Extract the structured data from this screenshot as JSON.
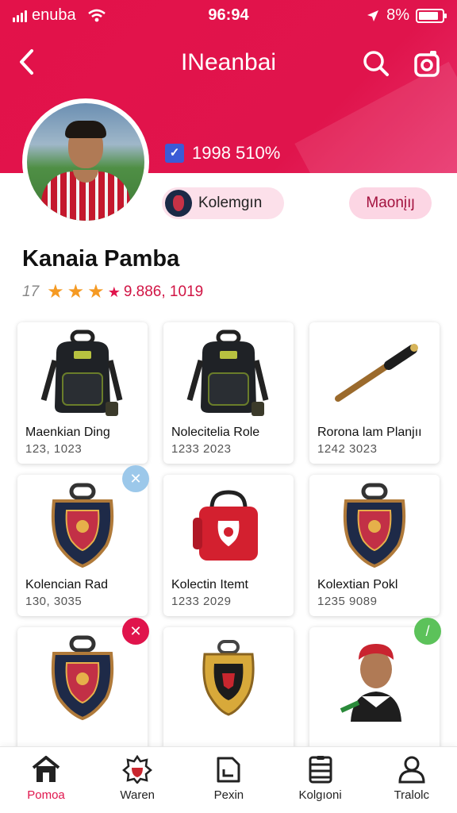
{
  "status_bar": {
    "carrier": "enuba",
    "time": "96:94",
    "battery": "8%"
  },
  "nav": {
    "title": "INeanbai",
    "back_icon": "chevron-left-icon",
    "search_icon": "search-icon",
    "camera_icon": "camera-icon"
  },
  "profile": {
    "verified_text": "1998 510%",
    "collection_label": "Kolemgın",
    "manage_label": "Maonįıȷ",
    "name": "Kanaia Pamba",
    "rating_number": "17",
    "rating_stars": 4,
    "rating_count": "9.886, 1019"
  },
  "items": [
    {
      "label": "Maenkian Ding",
      "code": "123, 1023",
      "image": "backpack-icon"
    },
    {
      "label": "Nolecitelia Role",
      "code": "1233 2023",
      "image": "backpack-icon"
    },
    {
      "label": "Rorona lam Planjıı",
      "code": "1242 3023",
      "image": "bat-icon"
    },
    {
      "label": "Kolencian Rad",
      "code": "130, 3035",
      "image": "crest-icon",
      "badge": "close"
    },
    {
      "label": "Kolectin Itemt",
      "code": "1233 2029",
      "image": "bag-icon"
    },
    {
      "label": "Kolextian Pokl",
      "code": "1235 9089",
      "image": "crest-icon"
    },
    {
      "label": "",
      "code": "",
      "image": "crest-icon",
      "badge": "remove"
    },
    {
      "label": "",
      "code": "",
      "image": "trophy-icon"
    },
    {
      "label": "",
      "code": "",
      "image": "player-icon",
      "badge": "edit"
    }
  ],
  "tabs": [
    {
      "label": "Pomoa",
      "icon": "home-icon",
      "active": true
    },
    {
      "label": "Waren",
      "icon": "badge-icon",
      "active": false
    },
    {
      "label": "Pexin",
      "icon": "document-icon",
      "active": false
    },
    {
      "label": "Kolgıoni",
      "icon": "list-icon",
      "active": false
    },
    {
      "label": "Tralolc",
      "icon": "user-icon",
      "active": false
    }
  ],
  "colors": {
    "brand": "#e0144c",
    "star": "#f59a23",
    "badge_close": "#9cc8ea",
    "badge_remove": "#e0144c",
    "badge_edit": "#5cc25a"
  }
}
